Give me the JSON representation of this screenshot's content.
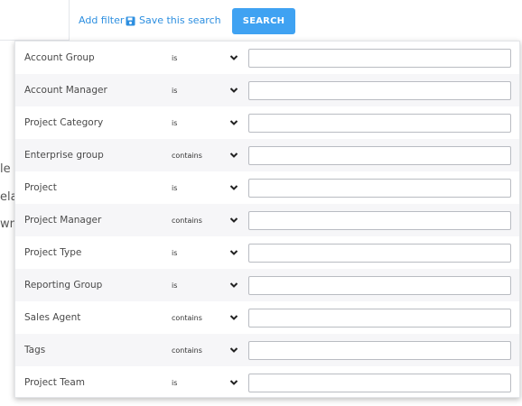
{
  "toolbar": {
    "add_filter": "Add filter",
    "save_search": "Save this search",
    "search_button": "SEARCH"
  },
  "background": {
    "fragment_1": "le",
    "fragment_2": "ela",
    "fragment_3": "wn C"
  },
  "filters": [
    {
      "label": "Account Group",
      "operator": "is",
      "value": ""
    },
    {
      "label": "Account Manager",
      "operator": "is",
      "value": ""
    },
    {
      "label": "Project Category",
      "operator": "is",
      "value": ""
    },
    {
      "label": "Enterprise group",
      "operator": "contains",
      "value": ""
    },
    {
      "label": "Project",
      "operator": "is",
      "value": ""
    },
    {
      "label": "Project Manager",
      "operator": "contains",
      "value": ""
    },
    {
      "label": "Project Type",
      "operator": "is",
      "value": ""
    },
    {
      "label": "Reporting Group",
      "operator": "is",
      "value": ""
    },
    {
      "label": "Sales Agent",
      "operator": "contains",
      "value": ""
    },
    {
      "label": "Tags",
      "operator": "contains",
      "value": ""
    },
    {
      "label": "Project Team",
      "operator": "is",
      "value": ""
    }
  ],
  "colors": {
    "accent": "#3fa2f2",
    "link": "#2d8fe0",
    "row_alt": "#f6f6f8"
  }
}
